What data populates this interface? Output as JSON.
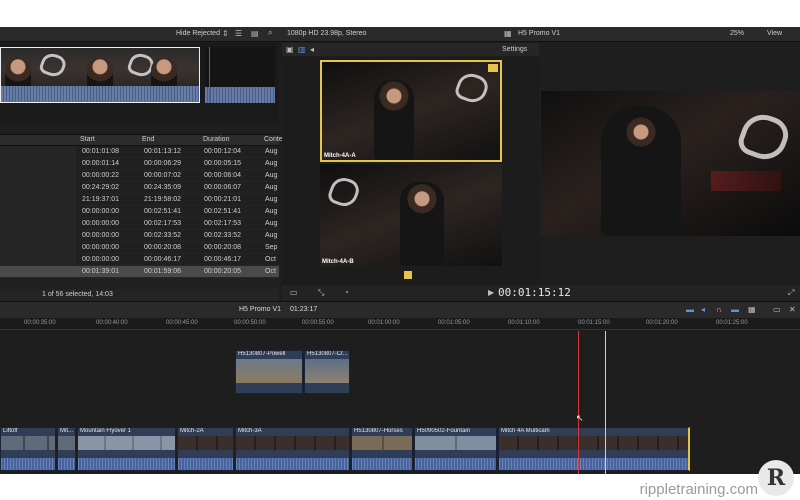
{
  "topbar": {
    "hide_rejected": "Hide Rejected",
    "format": "1080p HD 23.98p, Stereo",
    "project_title": "H5 Promo V1",
    "zoom": "25%",
    "view": "View"
  },
  "angle_viewer": {
    "settings": "Settings",
    "angles": [
      "Mitch-4A-A",
      "Mitch-4A-B"
    ]
  },
  "browser": {
    "columns": [
      "Start",
      "End",
      "Duration",
      "Conte"
    ],
    "rows": [
      [
        "00:01:01:08",
        "00:01:13:12",
        "00:00:12:04",
        "Aug"
      ],
      [
        "00:00:01:14",
        "00:00:06:29",
        "00:00:05:15",
        "Aug"
      ],
      [
        "00:00:00:22",
        "00:00:07:02",
        "00:00:06:04",
        "Aug"
      ],
      [
        "00:24:29:02",
        "00:24:35:09",
        "00:00:06:07",
        "Aug"
      ],
      [
        "21:19:37:01",
        "21:19:58:02",
        "00:00:21:01",
        "Aug"
      ],
      [
        "00:00:00:00",
        "00:02:51:41",
        "00:02:51:41",
        "Aug"
      ],
      [
        "00:00:00:00",
        "00:02:17:53",
        "00:02:17:53",
        "Aug"
      ],
      [
        "00:00:00:00",
        "00:02:33:52",
        "00:02:33:52",
        "Aug"
      ],
      [
        "00:00:00:00",
        "00:00:20:08",
        "00:00:20:08",
        "Sep"
      ],
      [
        "00:00:00:00",
        "00:00:46:17",
        "00:00:46:17",
        "Oct"
      ],
      [
        "00:01:39:01",
        "00:01:59:06",
        "00:00:20:05",
        "Oct"
      ]
    ],
    "status": "1 of 56 selected, 14:03"
  },
  "toolbar": {
    "timecode": "00:01:15:12"
  },
  "timeline": {
    "project": "H5 Promo V1",
    "duration": "01:23:17",
    "ruler": [
      "00:00:35:00",
      "00:00:40:00",
      "00:00:45:00",
      "00:00:50:00",
      "00:00:55:00",
      "00:01:00:00",
      "00:01:05:00",
      "00:01:10:00",
      "00:01:15:00",
      "00:01:20:00",
      "00:01:25:00"
    ],
    "connected_clips": [
      "H5130807-Powell",
      "H5130807-Cr..."
    ],
    "primary_clips": [
      "Liftoff",
      "Mit...",
      "Mountain Flyover 1",
      "Mitch-2A",
      "Mitch-3A",
      "H5130807-Horses",
      "H5090502-Fountain",
      "Mitch 4A Multicam"
    ]
  },
  "watermark": {
    "text": "rippletraining.com",
    "logo_letter": "R"
  },
  "icons": [
    "chevron-updown-icon",
    "filter-icon",
    "library-icon",
    "search-icon",
    "film-icon",
    "gear-icon",
    "close-icon",
    "play-icon",
    "audio-icon",
    "headphones-icon",
    "snapping-icon"
  ]
}
